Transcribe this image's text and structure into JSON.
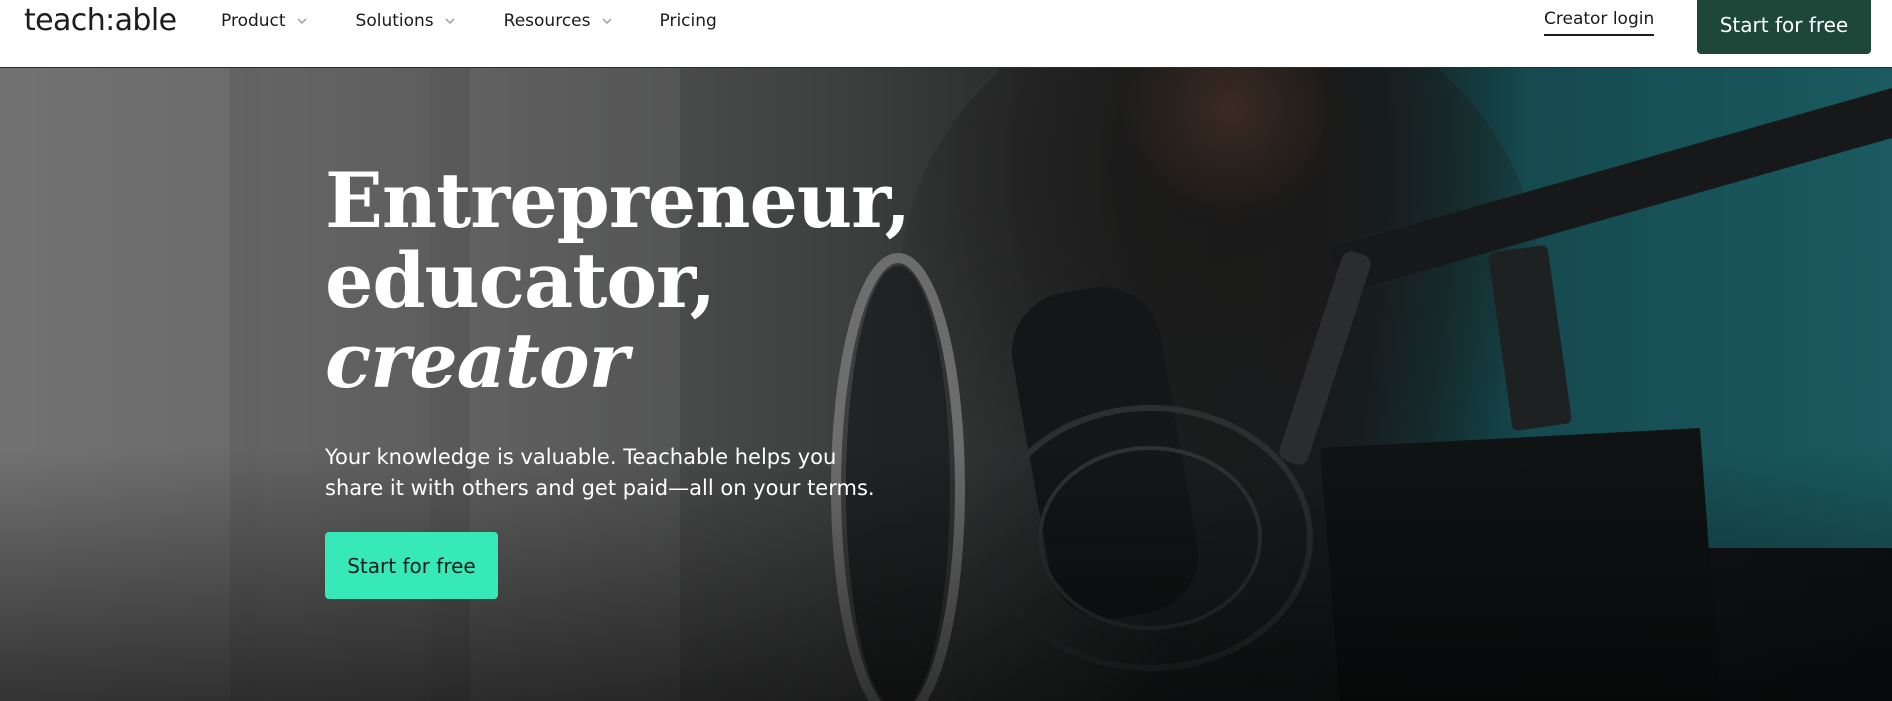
{
  "nav": {
    "logo": "teach:able",
    "items": [
      {
        "label": "Product",
        "has_dropdown": true
      },
      {
        "label": "Solutions",
        "has_dropdown": true
      },
      {
        "label": "Resources",
        "has_dropdown": true
      },
      {
        "label": "Pricing",
        "has_dropdown": false
      }
    ],
    "creator_login": "Creator login",
    "cta": "Start for free"
  },
  "hero": {
    "title_lines": [
      "Entrepreneur,",
      "educator,",
      "creator"
    ],
    "subtitle": "Your knowledge is valuable. Teachable helps you share it with others and get paid—all on your terms.",
    "cta": "Start for free"
  },
  "colors": {
    "nav_cta_bg": "#1c4739",
    "hero_cta_bg": "#37e8b8",
    "text_dark": "#1a1a1a",
    "text_light": "#ffffff"
  },
  "icons": {
    "dropdown": "chevron-down-icon"
  }
}
